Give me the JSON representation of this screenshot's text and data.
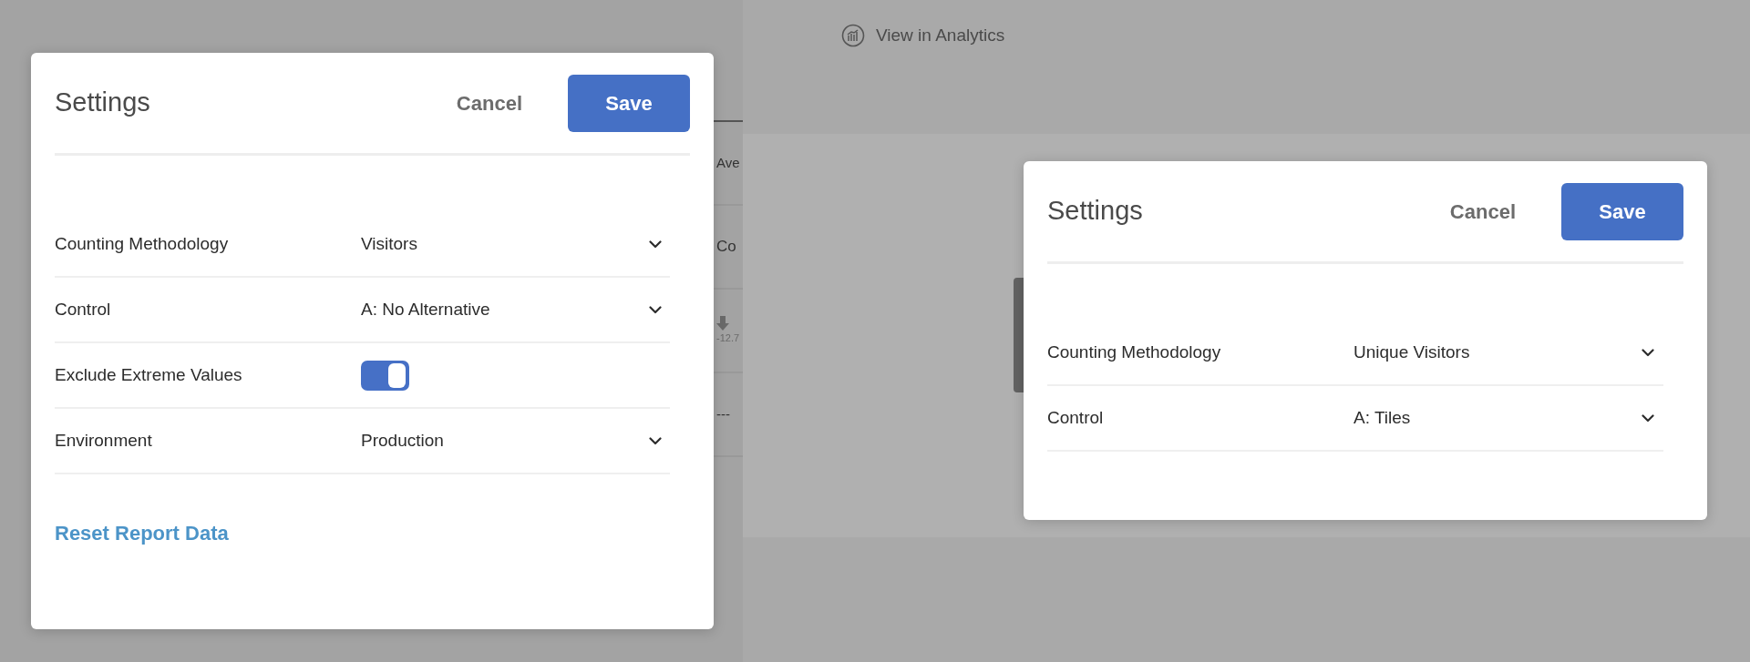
{
  "background": {
    "link": "View in Analytics",
    "fragments": [
      {
        "kind": "heading",
        "text": "Ave"
      },
      {
        "kind": "heading",
        "text": "Co"
      },
      {
        "kind": "delta",
        "text": "-12.7"
      },
      {
        "kind": "heading",
        "text": "---"
      }
    ]
  },
  "dialogs": [
    {
      "title": "Settings",
      "cancel": "Cancel",
      "save": "Save",
      "rows": [
        {
          "kind": "select",
          "label": "Counting Methodology",
          "value": "Visitors"
        },
        {
          "kind": "select",
          "label": "Control",
          "value": "A: No Alternative"
        },
        {
          "kind": "toggle",
          "label": "Exclude Extreme Values",
          "on": true
        },
        {
          "kind": "select",
          "label": "Environment",
          "value": "Production"
        }
      ],
      "reset_link": "Reset Report Data"
    },
    {
      "title": "Settings",
      "cancel": "Cancel",
      "save": "Save",
      "rows": [
        {
          "kind": "select",
          "label": "Counting Methodology",
          "value": "Unique Visitors"
        },
        {
          "kind": "select",
          "label": "Control",
          "value": "A: Tiles"
        }
      ]
    }
  ]
}
